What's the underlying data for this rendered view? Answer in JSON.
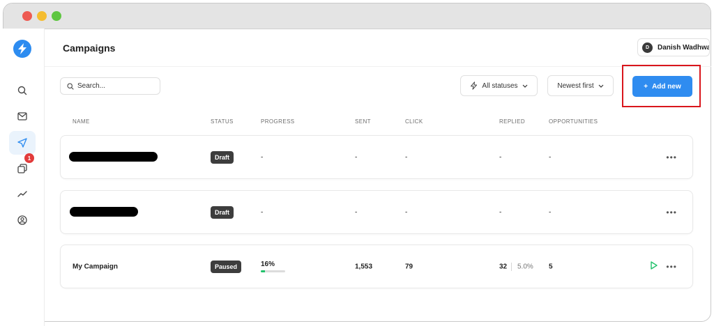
{
  "app": {
    "title": "Campaigns",
    "user": {
      "name": "Danish Wadhwa",
      "initial": "D"
    }
  },
  "sidebar": {
    "items": [
      {
        "icon": "search-icon"
      },
      {
        "icon": "mail-icon"
      },
      {
        "icon": "send-icon",
        "active": true
      },
      {
        "icon": "copy-icon",
        "badge": "1"
      },
      {
        "icon": "analytics-icon"
      },
      {
        "icon": "user-circle-icon"
      }
    ]
  },
  "toolbar": {
    "search_placeholder": "Search...",
    "status_filter": "All statuses",
    "sort": "Newest first",
    "add_new": "Add new"
  },
  "table": {
    "columns": [
      "NAME",
      "STATUS",
      "PROGRESS",
      "SENT",
      "CLICK",
      "REPLIED",
      "OPPORTUNITIES"
    ],
    "rows": [
      {
        "name": "",
        "status": "Draft",
        "progress": "-",
        "sent": "-",
        "click": "-",
        "replied": "-",
        "opportunities": "-"
      },
      {
        "name": "",
        "status": "Draft",
        "progress": "-",
        "sent": "-",
        "click": "-",
        "replied": "-",
        "opportunities": "-"
      },
      {
        "name": "My Campaign",
        "status": "Paused",
        "progress": "16%",
        "progress_value": 16,
        "sent": "1,553",
        "click": "79",
        "replied": "32",
        "replied_rate": "5.0%",
        "opportunities": "5"
      }
    ]
  },
  "colors": {
    "accent": "#2f8cf0",
    "progress": "#21c16b",
    "badge": "#e23b3b",
    "highlight": "#d9161c"
  }
}
